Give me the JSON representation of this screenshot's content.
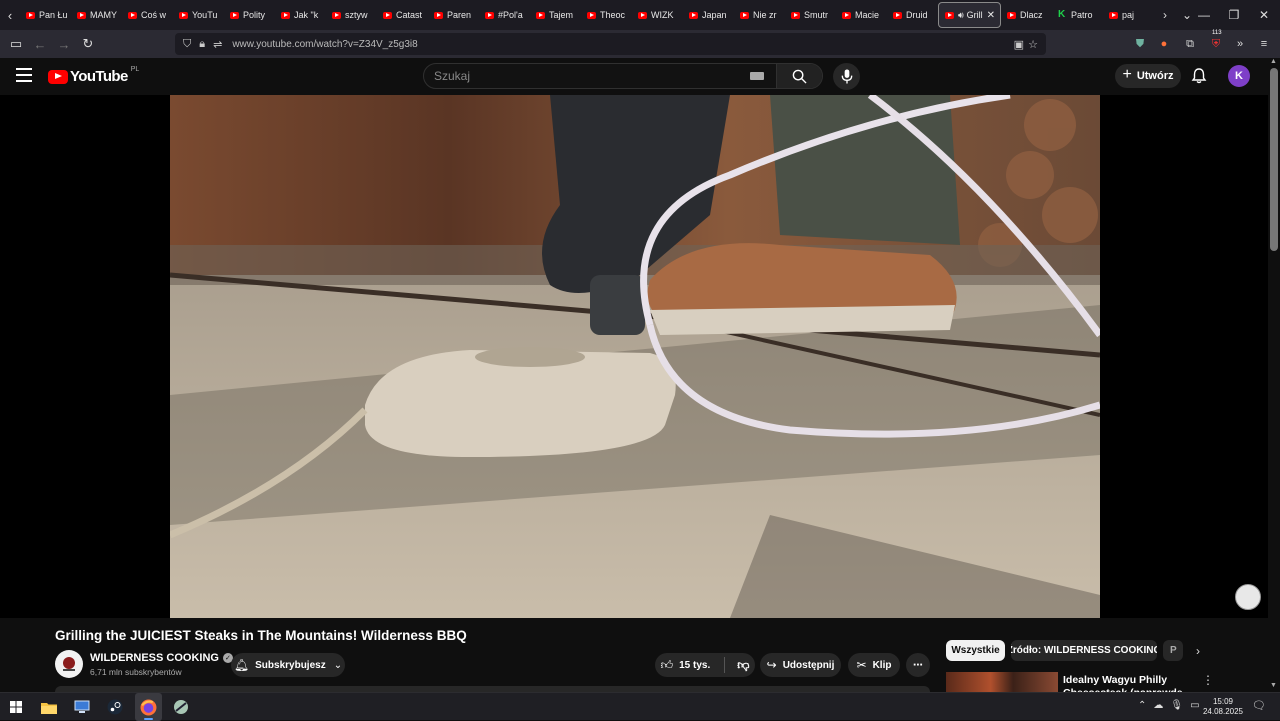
{
  "browser": {
    "tabs": [
      {
        "label": "Pan Łu",
        "favicon": "youtube-icon"
      },
      {
        "label": "MAMY",
        "favicon": "youtube-icon"
      },
      {
        "label": "Coś w",
        "favicon": "youtube-icon"
      },
      {
        "label": "YouTu",
        "favicon": "youtube-icon"
      },
      {
        "label": "Polity",
        "favicon": "youtube-icon"
      },
      {
        "label": "Jak \"k",
        "favicon": "youtube-icon"
      },
      {
        "label": "sztyw",
        "favicon": "youtube-icon"
      },
      {
        "label": "Catast",
        "favicon": "youtube-icon"
      },
      {
        "label": "Paren",
        "favicon": "youtube-icon"
      },
      {
        "label": "#Pol'a",
        "favicon": "youtube-icon"
      },
      {
        "label": "Tajem",
        "favicon": "youtube-icon"
      },
      {
        "label": "Theoc",
        "favicon": "youtube-icon"
      },
      {
        "label": "WIZK",
        "favicon": "youtube-icon"
      },
      {
        "label": "Japan",
        "favicon": "youtube-icon"
      },
      {
        "label": "Nie zr",
        "favicon": "youtube-icon"
      },
      {
        "label": "Smutr",
        "favicon": "youtube-icon"
      },
      {
        "label": "Macie",
        "favicon": "youtube-icon"
      },
      {
        "label": "Druid",
        "favicon": "youtube-icon"
      },
      {
        "label": "Grill",
        "favicon": "youtube-icon",
        "active": true
      },
      {
        "label": "Dlacz",
        "favicon": "youtube-icon"
      },
      {
        "label": "Patro",
        "favicon": "kick-icon"
      },
      {
        "label": "paj",
        "favicon": "youtube-icon"
      }
    ],
    "url": "www.youtube.com/watch?v=Z34V_z5g3i8",
    "extension_badge": "113"
  },
  "youtube": {
    "logo_text": "YouTube",
    "country_code": "PL",
    "search_placeholder": "Szukaj",
    "create_label": "Utwórz",
    "avatar_letter": "K",
    "accent_color": "#ff0000"
  },
  "video": {
    "title": "Grilling the JUICIEST Steaks in The Mountains! Wilderness BBQ",
    "channel_name": "WILDERNESS COOKING",
    "subscribers": "6,71 mln subskrybentów",
    "subscribe_label": "Subskrybujesz",
    "likes": "15 tys.",
    "share_label": "Udostępnij",
    "clip_label": "Klip"
  },
  "sidebar": {
    "chips": [
      "Wszystkie",
      "Źródło: WILDERNESS COOKING",
      "P"
    ],
    "recommendation_title": "Idealny Wagyu Philly Cheesesteak (naprawdę drogi)"
  },
  "taskbar": {
    "time": "15:09",
    "date": "24.08.2025"
  }
}
